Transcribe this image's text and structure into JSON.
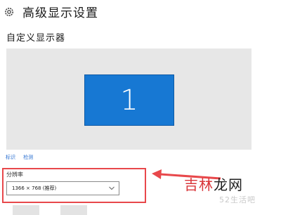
{
  "header": {
    "title": "高级显示设置",
    "icon": "gear-icon"
  },
  "section": {
    "title": "自定义显示器"
  },
  "preview": {
    "monitor_number": "1",
    "monitor_color": "#1778d3"
  },
  "links": {
    "identify": "标识",
    "detect": "检测"
  },
  "resolution": {
    "label": "分辨率",
    "selected": "1366 × 768 (推荐)"
  },
  "annotation": {
    "color": "#e8484b"
  },
  "watermark": {
    "part1": "吉林",
    "part2": "龙网",
    "sub": "52生活吧"
  }
}
